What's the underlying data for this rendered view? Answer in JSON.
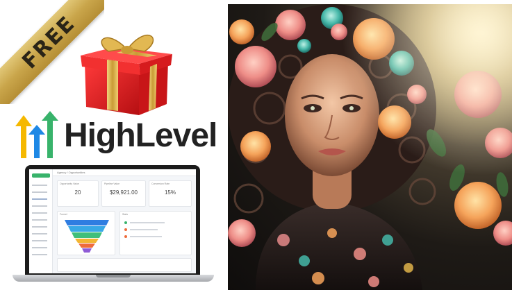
{
  "badge": {
    "text": "FREE"
  },
  "brand": {
    "name": "HighLevel"
  },
  "dashboard": {
    "header": "Agency / Opportunities",
    "cards": [
      {
        "label": "Opportunity Value",
        "value": "20"
      },
      {
        "label": "Pipeline Value",
        "value": "$29,921.00"
      },
      {
        "label": "Conversion Rate",
        "value": "15%"
      }
    ],
    "panels": {
      "funnel": "Funnel",
      "stats": "Stats"
    }
  },
  "colors": {
    "ribbon": "#c9a54a",
    "gift_red": "#e01f1f",
    "gift_ribbon": "#d9b04a",
    "logo_yellow": "#f5b800",
    "logo_green": "#38b36b",
    "logo_blue": "#1e88e5",
    "dash_green": "#38b36b"
  },
  "icons": [
    "gift-box-icon",
    "highlevel-arrows-logo-icon",
    "laptop-icon"
  ]
}
